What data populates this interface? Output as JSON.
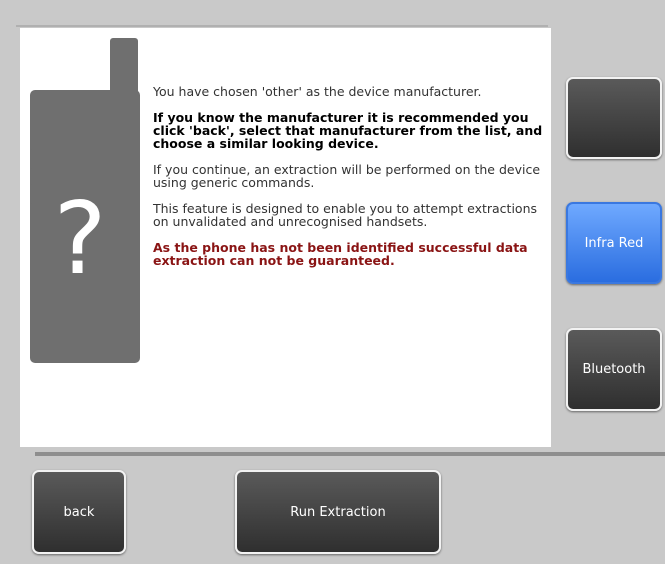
{
  "message": {
    "line1": "You have chosen 'other' as the device manufacturer.",
    "line2": "If you know the manufacturer it is recommended you click 'back', select that manufacturer from the list, and choose a similar looking device.",
    "line3": "If you continue, an extraction will be performed on the device using generic commands.",
    "line4": "This feature is designed to enable you to attempt extractions on unvalidated and unrecognised handsets.",
    "warning": "As the phone has not been identified successful data extraction can not be guaranteed."
  },
  "phone_graphic": {
    "symbol": "?"
  },
  "side_buttons": {
    "top": "",
    "infra_red": "Infra Red",
    "bluetooth": "Bluetooth"
  },
  "bottom_buttons": {
    "back": "back",
    "run": "Run Extraction"
  },
  "colors": {
    "panel": "#ffffff",
    "background": "#c9c9c9",
    "selected_button": "#4a8cf0",
    "warning_text": "#8a1414"
  }
}
